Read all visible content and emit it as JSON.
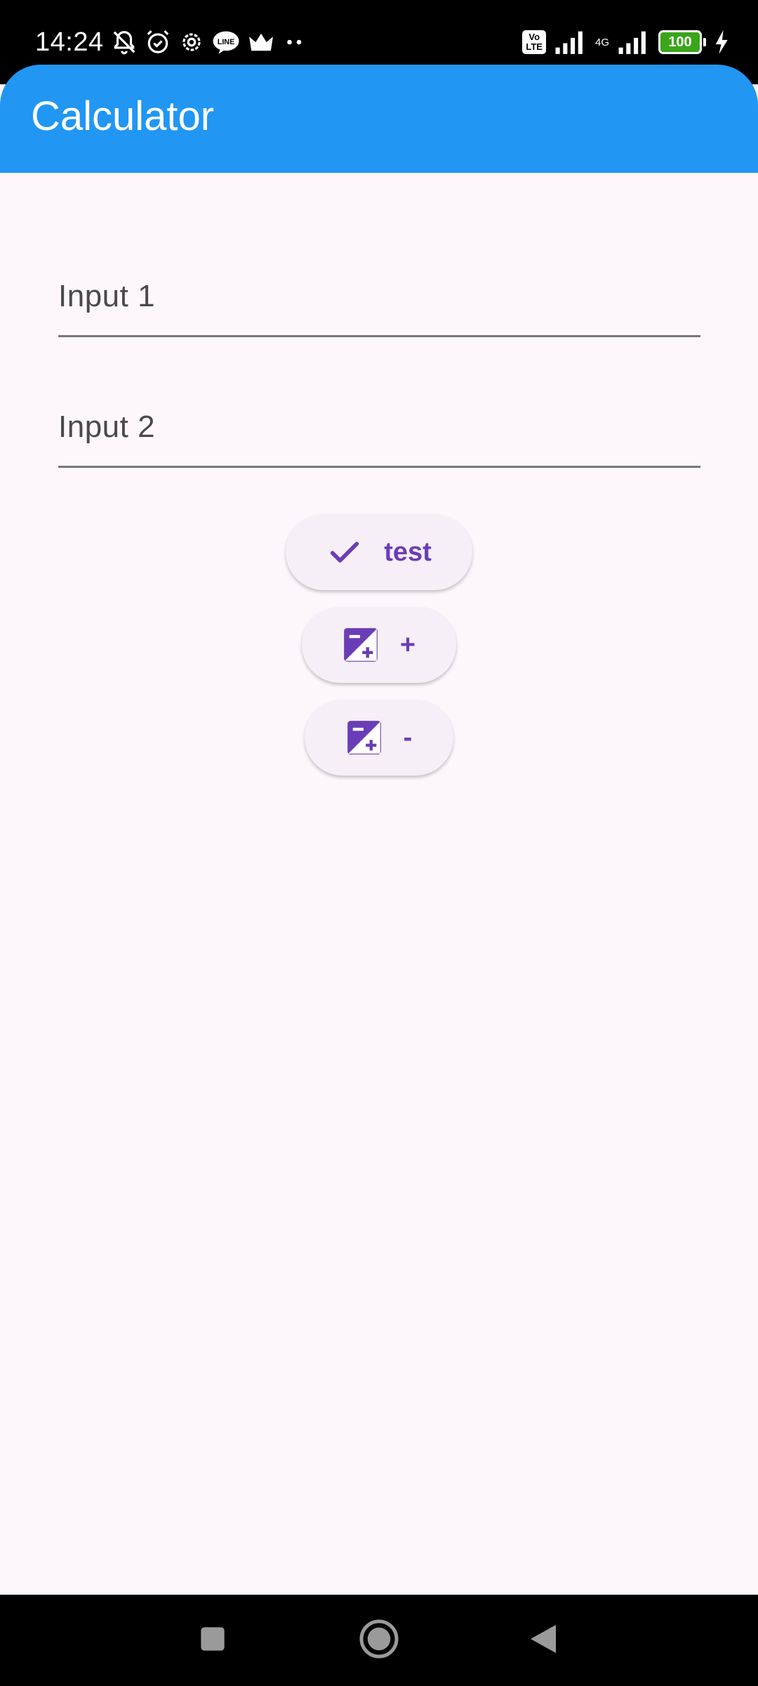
{
  "status_bar": {
    "time": "14:24",
    "volte_line1": "Vo",
    "volte_line2": "LTE",
    "network": "4G",
    "battery": "100"
  },
  "app_bar": {
    "title": "Calculator",
    "color": "#2196f3"
  },
  "inputs": [
    {
      "label": "Input 1",
      "value": ""
    },
    {
      "label": "Input 2",
      "value": ""
    }
  ],
  "buttons": [
    {
      "label": "test",
      "icon": "check-icon"
    },
    {
      "label": "+",
      "icon": "exposure-icon"
    },
    {
      "label": "-",
      "icon": "exposure-icon"
    }
  ],
  "colors": {
    "accent": "#6a3db8",
    "button_bg": "#f6eff7",
    "background": "#fdf7fc"
  },
  "nav_bar": {
    "icons": [
      "recents-icon",
      "home-icon",
      "back-icon"
    ]
  }
}
